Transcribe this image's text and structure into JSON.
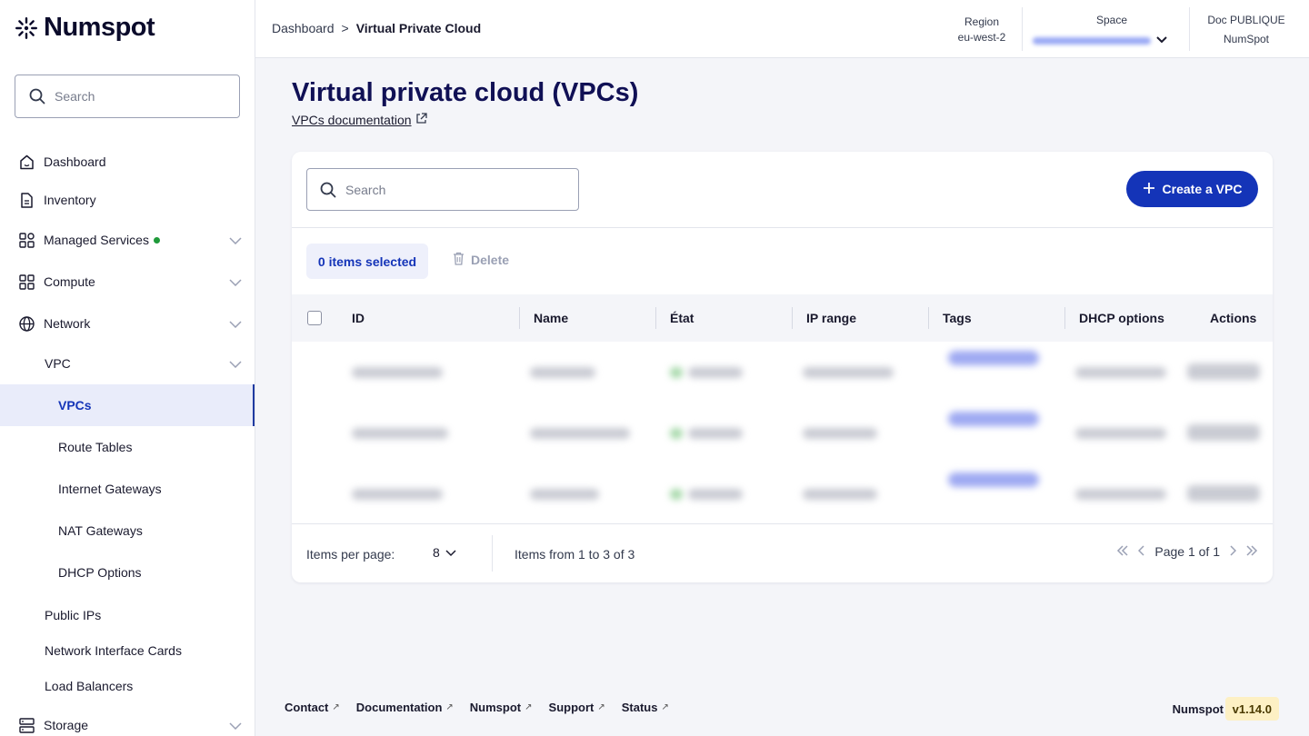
{
  "brand": {
    "name": "Numspot"
  },
  "sidebar": {
    "search_placeholder": "Search",
    "items": [
      {
        "label": "Dashboard"
      },
      {
        "label": "Inventory"
      },
      {
        "label": "Managed Services"
      },
      {
        "label": "Compute"
      },
      {
        "label": "Network"
      },
      {
        "label": "VPC"
      },
      {
        "label": "VPCs"
      },
      {
        "label": "Route Tables"
      },
      {
        "label": "Internet Gateways"
      },
      {
        "label": "NAT Gateways"
      },
      {
        "label": "DHCP Options"
      },
      {
        "label": "Public IPs"
      },
      {
        "label": "Network Interface Cards"
      },
      {
        "label": "Load Balancers"
      },
      {
        "label": "Storage"
      }
    ]
  },
  "header": {
    "breadcrumb": {
      "root": "Dashboard",
      "separator": ">",
      "current": "Virtual Private Cloud"
    },
    "region": {
      "label": "Region",
      "value": "eu-west-2"
    },
    "space": {
      "label": "Space"
    },
    "org": {
      "label": "Doc PUBLIQUE",
      "value": "NumSpot"
    }
  },
  "main": {
    "title": "Virtual private cloud (VPCs)",
    "doc_link": "VPCs documentation",
    "search_placeholder": "Search",
    "create_button": "Create a VPC",
    "selected_count": "0 items selected",
    "delete_label": "Delete",
    "columns": [
      "ID",
      "Name",
      "État",
      "IP range",
      "Tags",
      "DHCP options",
      "Actions"
    ],
    "footer": {
      "items_per_page_label": "Items per page:",
      "items_per_page_value": "8",
      "range_text": "Items from 1 to 3 of 3",
      "page_text": "Page 1 of 1"
    }
  },
  "footer": {
    "links": [
      "Contact",
      "Documentation",
      "Numspot",
      "Support",
      "Status"
    ],
    "brand": "Numspot",
    "version": "v1.14.0"
  },
  "colors": {
    "primary": "#1434b8",
    "title": "#101055",
    "status_green": "#1f9a3a",
    "version_bg": "#fdf0c4"
  }
}
